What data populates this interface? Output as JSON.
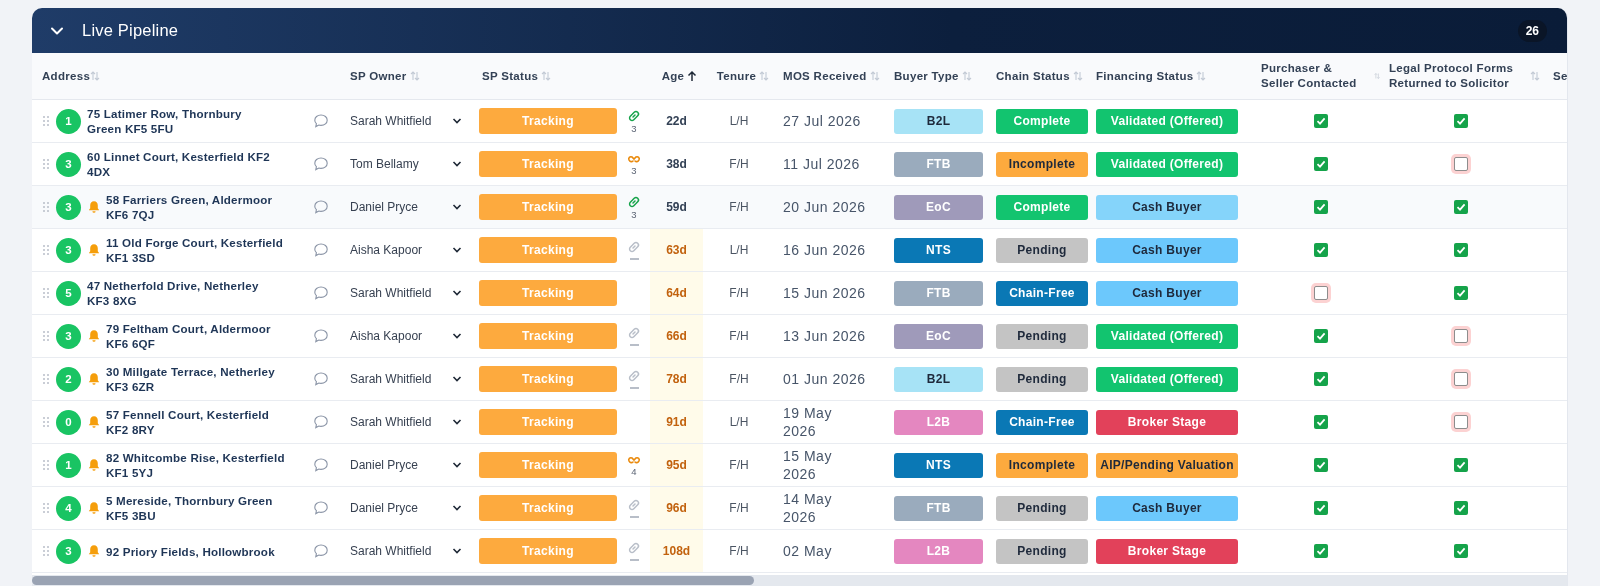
{
  "panel": {
    "title": "Live Pipeline",
    "expanded": true,
    "count": "26"
  },
  "columns": [
    {
      "label": "Address",
      "sorted": false
    },
    {
      "label": "SP Owner",
      "sorted": false
    },
    {
      "label": "SP Status",
      "sorted": false
    },
    {
      "label": "Age",
      "sorted": true
    },
    {
      "label": "Tenure",
      "sorted": false
    },
    {
      "label": "MOS Received",
      "sorted": false
    },
    {
      "label": "Buyer Type",
      "sorted": false
    },
    {
      "label": "Chain Status",
      "sorted": false
    },
    {
      "label": "Financing Status",
      "sorted": false
    },
    {
      "label": "Purchaser & Seller Contacted",
      "sorted": false
    },
    {
      "label": "Legal Protocol Forms Returned to Solicitor",
      "sorted": false
    },
    {
      "label": "Se"
    }
  ],
  "rows": [
    {
      "number": "1",
      "alert": false,
      "highlighted": false,
      "address": "75 Latimer Row, Thornbury Green KF5 5FU",
      "owner": "Sarah Whitfield",
      "status": "Tracking",
      "link": {
        "kind": "linked",
        "count": "3"
      },
      "age": "22d",
      "overdue": false,
      "tenure": "L/H",
      "mos": "27 Jul 2026",
      "buyer": {
        "label": "B2L",
        "color": "#a7e3f6"
      },
      "chain": {
        "label": "Complete",
        "color": "#12c46f"
      },
      "financing": {
        "label": "Validated (Offered)",
        "color": "#12c46f"
      },
      "contacted": true,
      "forms_returned": true
    },
    {
      "number": "3",
      "alert": false,
      "highlighted": false,
      "address": "60 Linnet Court, Kesterfield KF2 4DX",
      "owner": "Tom Bellamy",
      "status": "Tracking",
      "link": {
        "kind": "partial",
        "count": "3"
      },
      "age": "38d",
      "overdue": false,
      "tenure": "F/H",
      "mos": "11 Jul 2026",
      "buyer": {
        "label": "FTB",
        "color": "#9aabbd"
      },
      "chain": {
        "label": "Incomplete",
        "color": "#fdaa3e"
      },
      "financing": {
        "label": "Validated (Offered)",
        "color": "#12c46f"
      },
      "contacted": true,
      "forms_returned": false
    },
    {
      "number": "3",
      "alert": true,
      "highlighted": true,
      "address": "58 Farriers Green, Aldermoor KF6 7QJ",
      "owner": "Daniel Pryce",
      "status": "Tracking",
      "link": {
        "kind": "linked",
        "count": "3"
      },
      "age": "59d",
      "overdue": false,
      "tenure": "F/H",
      "mos": "20 Jun 2026",
      "buyer": {
        "label": "EoC",
        "color": "#9f9aba"
      },
      "chain": {
        "label": "Complete",
        "color": "#12c46f"
      },
      "financing": {
        "label": "Cash Buyer",
        "color": "#85d4fa"
      },
      "contacted": true,
      "forms_returned": true
    },
    {
      "number": "3",
      "alert": true,
      "highlighted": false,
      "address": "11 Old Forge Court, Kesterfield KF1 3SD",
      "owner": "Aisha Kapoor",
      "status": "Tracking",
      "link": {
        "kind": "none"
      },
      "age": "63d",
      "overdue": true,
      "tenure": "L/H",
      "mos": "16 Jun 2026",
      "buyer": {
        "label": "NTS",
        "color": "#0a78b5"
      },
      "chain": {
        "label": "Pending",
        "color": "#c4c4c4"
      },
      "financing": {
        "label": "Cash Buyer",
        "color": "#6cc8fc"
      },
      "contacted": true,
      "forms_returned": true
    },
    {
      "number": "5",
      "alert": false,
      "highlighted": false,
      "address": "47 Netherfold Drive, Netherley KF3 8XG",
      "owner": "Sarah Whitfield",
      "status": "Tracking",
      "age": "64d",
      "overdue": true,
      "tenure": "F/H",
      "mos": "15 Jun 2026",
      "buyer": {
        "label": "FTB",
        "color": "#9aabbd"
      },
      "chain": {
        "label": "Chain-Free",
        "color": "#0a78b5"
      },
      "financing": {
        "label": "Cash Buyer",
        "color": "#6cc8fc"
      },
      "contacted": false,
      "forms_returned": true
    },
    {
      "number": "3",
      "alert": true,
      "highlighted": false,
      "address": "79 Feltham Court, Aldermoor KF6 6QF",
      "owner": "Aisha Kapoor",
      "status": "Tracking",
      "link": {
        "kind": "none"
      },
      "age": "66d",
      "overdue": true,
      "tenure": "F/H",
      "mos": "13 Jun 2026",
      "buyer": {
        "label": "EoC",
        "color": "#9f9aba"
      },
      "chain": {
        "label": "Pending",
        "color": "#c4c4c4"
      },
      "financing": {
        "label": "Validated (Offered)",
        "color": "#12c46f"
      },
      "contacted": true,
      "forms_returned": false
    },
    {
      "number": "2",
      "alert": true,
      "highlighted": false,
      "address": "30 Millgate Terrace, Netherley KF3 6ZR",
      "owner": "Sarah Whitfield",
      "status": "Tracking",
      "link": {
        "kind": "none"
      },
      "age": "78d",
      "overdue": true,
      "tenure": "F/H",
      "mos": "01 Jun 2026",
      "buyer": {
        "label": "B2L",
        "color": "#a7e3f6"
      },
      "chain": {
        "label": "Pending",
        "color": "#c4c4c4"
      },
      "financing": {
        "label": "Validated (Offered)",
        "color": "#12c46f"
      },
      "contacted": true,
      "forms_returned": false
    },
    {
      "number": "0",
      "alert": true,
      "highlighted": false,
      "address": "57 Fennell Court, Kesterfield KF2 8RY",
      "owner": "Sarah Whitfield",
      "status": "Tracking",
      "age": "91d",
      "overdue": true,
      "tenure": "L/H",
      "mos": "19 May 2026",
      "buyer": {
        "label": "L2B",
        "color": "#e487c0"
      },
      "chain": {
        "label": "Chain-Free",
        "color": "#0a78b5"
      },
      "financing": {
        "label": "Broker Stage",
        "color": "#e2415a"
      },
      "contacted": true,
      "forms_returned": false
    },
    {
      "number": "1",
      "alert": true,
      "highlighted": false,
      "address": "82 Whitcombe Rise, Kesterfield KF1 5YJ",
      "owner": "Daniel Pryce",
      "status": "Tracking",
      "link": {
        "kind": "partial",
        "count": "4"
      },
      "age": "95d",
      "overdue": true,
      "tenure": "F/H",
      "mos": "15 May 2026",
      "buyer": {
        "label": "NTS",
        "color": "#0a78b5"
      },
      "chain": {
        "label": "Incomplete",
        "color": "#fdaa3e"
      },
      "financing": {
        "label": "AIP/Pending Valuation",
        "color": "#fdaa3e"
      },
      "contacted": true,
      "forms_returned": true
    },
    {
      "number": "4",
      "alert": true,
      "highlighted": false,
      "address": "5 Mereside, Thornbury Green KF5 3BU",
      "owner": "Daniel Pryce",
      "status": "Tracking",
      "link": {
        "kind": "none"
      },
      "age": "96d",
      "overdue": true,
      "tenure": "F/H",
      "mos": "14 May 2026",
      "buyer": {
        "label": "FTB",
        "color": "#9aabbd"
      },
      "chain": {
        "label": "Pending",
        "color": "#c4c4c4"
      },
      "financing": {
        "label": "Cash Buyer",
        "color": "#6cc8fc"
      },
      "contacted": true,
      "forms_returned": true
    },
    {
      "number": "3",
      "alert": true,
      "highlighted": false,
      "address": "92 Priory Fields, Hollowbrook",
      "owner": "Sarah Whitfield",
      "status": "Tracking",
      "link": {
        "kind": "none"
      },
      "age": "108d",
      "overdue": true,
      "tenure": "F/H",
      "mos": "02 May",
      "buyer": {
        "label": "L2B",
        "color": "#e487c0"
      },
      "chain": {
        "label": "Pending",
        "color": "#c4c4c4"
      },
      "financing": {
        "label": "Broker Stage",
        "color": "#e2415a"
      },
      "contacted": true,
      "forms_returned": true
    }
  ]
}
